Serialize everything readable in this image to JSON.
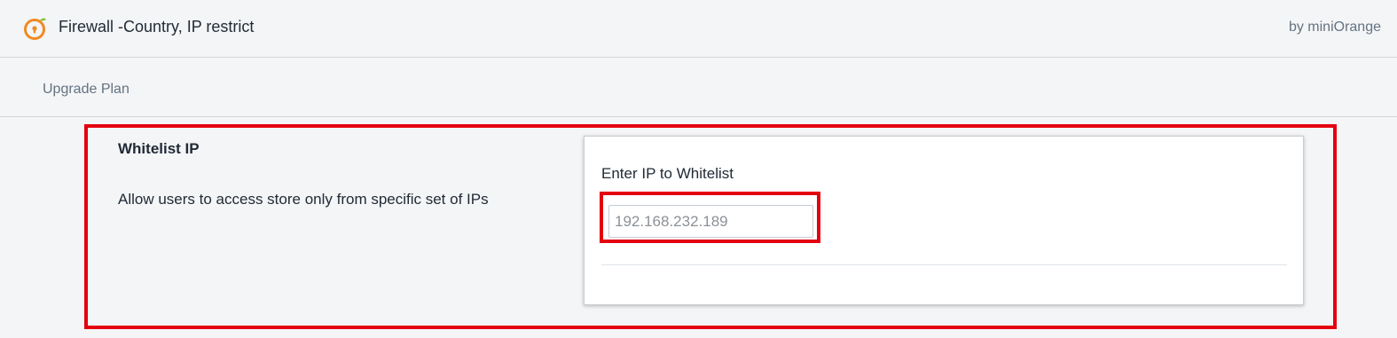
{
  "header": {
    "app_title": "Firewall -Country, IP restrict",
    "byline": "by miniOrange",
    "logo_icon": "miniorange-lock-icon"
  },
  "nav": {
    "upgrade_label": "Upgrade Plan"
  },
  "section": {
    "title": "Whitelist IP",
    "description": "Allow users to access store only from specific set of IPs"
  },
  "form": {
    "field_label": "Enter IP to Whitelist",
    "ip_placeholder": "192.168.232.189",
    "ip_value": ""
  },
  "colors": {
    "highlight": "#e3000f",
    "logo_orange": "#f08a24",
    "logo_green": "#7bbf2a"
  }
}
